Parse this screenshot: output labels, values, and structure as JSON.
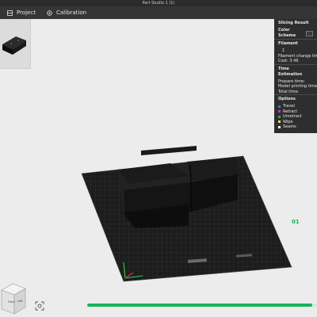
{
  "window": {
    "title": "Part Studio 1 (1)"
  },
  "tabs": [
    {
      "label": "Project",
      "icon": "project-icon"
    },
    {
      "label": "Calibration",
      "icon": "calibration-icon"
    }
  ],
  "slicing_result": {
    "title": "Slicing Result",
    "color_scheme_label": "Color Scheme",
    "filament_header": "Filament",
    "filament_index": "1",
    "filament_change_label": "Filament change time",
    "cost_label": "Cost:",
    "cost_value": "3.46",
    "time_header": "Time Estimation",
    "prepare_time_label": "Prepare time:",
    "model_printing_time_label": "Model printing time:",
    "total_time_label": "Total time:",
    "options_header": "Options",
    "options": [
      {
        "label": "Travel",
        "color": "#3f6fd6"
      },
      {
        "label": "Retract",
        "color": "#c239c2"
      },
      {
        "label": "Unretract",
        "color": "#30a66a"
      },
      {
        "label": "Wipe",
        "color": "#e8e24a"
      },
      {
        "label": "Seams",
        "color": "#f0f0f0"
      }
    ]
  },
  "plate": {
    "label": "01",
    "label_color": "#17b35a"
  },
  "view_cube": {
    "front_label": "Front",
    "left_label": "Left"
  },
  "progress": {
    "fraction": 0.98,
    "color": "#17b35a"
  }
}
